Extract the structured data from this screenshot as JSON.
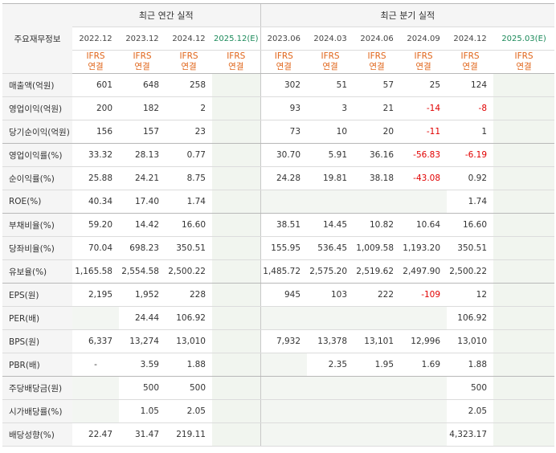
{
  "header": {
    "corner_label": "주요재무정보",
    "annual_group": "최근 연간 실적",
    "quarter_group": "최근 분기 실적",
    "annual_periods": [
      "2022.12",
      "2023.12",
      "2024.12",
      "2025.12(E)"
    ],
    "quarter_periods": [
      "2023.06",
      "2024.03",
      "2024.06",
      "2024.09",
      "2024.12",
      "2025.03(E)"
    ],
    "ifrs_line1": "IFRS",
    "ifrs_line2": "연결"
  },
  "rows": [
    {
      "label": "매출액(억원)",
      "annual": [
        "601",
        "648",
        "258",
        ""
      ],
      "quarter": [
        "302",
        "51",
        "57",
        "25",
        "124",
        ""
      ]
    },
    {
      "label": "영업이익(억원)",
      "annual": [
        "200",
        "182",
        "2",
        ""
      ],
      "quarter": [
        "93",
        "3",
        "21",
        "-14",
        "-8",
        ""
      ]
    },
    {
      "label": "당기순이익(억원)",
      "annual": [
        "156",
        "157",
        "23",
        ""
      ],
      "quarter": [
        "73",
        "10",
        "20",
        "-11",
        "1",
        ""
      ]
    },
    {
      "label": "영업이익률(%)",
      "annual": [
        "33.32",
        "28.13",
        "0.77",
        ""
      ],
      "quarter": [
        "30.70",
        "5.91",
        "36.16",
        "-56.83",
        "-6.19",
        ""
      ]
    },
    {
      "label": "순이익률(%)",
      "annual": [
        "25.88",
        "24.21",
        "8.75",
        ""
      ],
      "quarter": [
        "24.28",
        "19.81",
        "38.18",
        "-43.08",
        "0.92",
        ""
      ]
    },
    {
      "label": "ROE(%)",
      "annual": [
        "40.34",
        "17.40",
        "1.74",
        ""
      ],
      "quarter": [
        "",
        "",
        "",
        "",
        "1.74",
        ""
      ]
    },
    {
      "label": "부채비율(%)",
      "annual": [
        "59.20",
        "14.42",
        "16.60",
        ""
      ],
      "quarter": [
        "38.51",
        "14.45",
        "10.82",
        "10.64",
        "16.60",
        ""
      ]
    },
    {
      "label": "당좌비율(%)",
      "annual": [
        "70.04",
        "698.23",
        "350.51",
        ""
      ],
      "quarter": [
        "155.95",
        "536.45",
        "1,009.58",
        "1,193.20",
        "350.51",
        ""
      ]
    },
    {
      "label": "유보율(%)",
      "annual": [
        "1,165.58",
        "2,554.58",
        "2,500.22",
        ""
      ],
      "quarter": [
        "1,485.72",
        "2,575.20",
        "2,519.62",
        "2,497.90",
        "2,500.22",
        ""
      ]
    },
    {
      "label": "EPS(원)",
      "annual": [
        "2,195",
        "1,952",
        "228",
        ""
      ],
      "quarter": [
        "945",
        "103",
        "222",
        "-109",
        "12",
        ""
      ]
    },
    {
      "label": "PER(배)",
      "annual": [
        "",
        "24.44",
        "106.92",
        ""
      ],
      "quarter": [
        "",
        "",
        "",
        "",
        "106.92",
        ""
      ]
    },
    {
      "label": "BPS(원)",
      "annual": [
        "6,337",
        "13,274",
        "13,010",
        ""
      ],
      "quarter": [
        "7,932",
        "13,378",
        "13,101",
        "12,996",
        "13,010",
        ""
      ]
    },
    {
      "label": "PBR(배)",
      "annual": [
        "-",
        "3.59",
        "1.88",
        ""
      ],
      "quarter": [
        "",
        "2.35",
        "1.95",
        "1.69",
        "1.88",
        ""
      ]
    },
    {
      "label": "주당배당금(원)",
      "annual": [
        "",
        "500",
        "500",
        ""
      ],
      "quarter": [
        "",
        "",
        "",
        "",
        "500",
        ""
      ]
    },
    {
      "label": "시가배당률(%)",
      "annual": [
        "",
        "1.05",
        "2.05",
        ""
      ],
      "quarter": [
        "",
        "",
        "",
        "",
        "2.05",
        ""
      ]
    },
    {
      "label": "배당성향(%)",
      "annual": [
        "22.47",
        "31.47",
        "219.11",
        ""
      ],
      "quarter": [
        "",
        "",
        "",
        "",
        "4,323.17",
        ""
      ]
    }
  ],
  "colors": {
    "negative": "#e10000",
    "ifrs": "#e0651a",
    "estimate_header": "#1b8a5a"
  }
}
